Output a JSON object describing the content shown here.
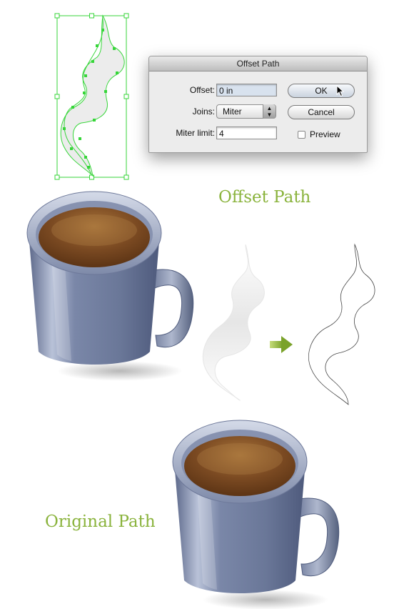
{
  "dialog": {
    "title": "Offset Path",
    "offset_label": "Offset:",
    "offset_value": "0 in",
    "joins_label": "Joins:",
    "joins_value": "Miter",
    "miter_label": "Miter limit:",
    "miter_value": "4",
    "ok_label": "OK",
    "cancel_label": "Cancel",
    "preview_label": "Preview",
    "preview_checked": false
  },
  "headings": {
    "offset": "Offset Path",
    "original": "Original Path"
  },
  "colors": {
    "accent_green": "#8ab33c",
    "selection_green": "#37d63a",
    "mug_body": "#6f7c9c",
    "coffee": "#7a4a22"
  }
}
